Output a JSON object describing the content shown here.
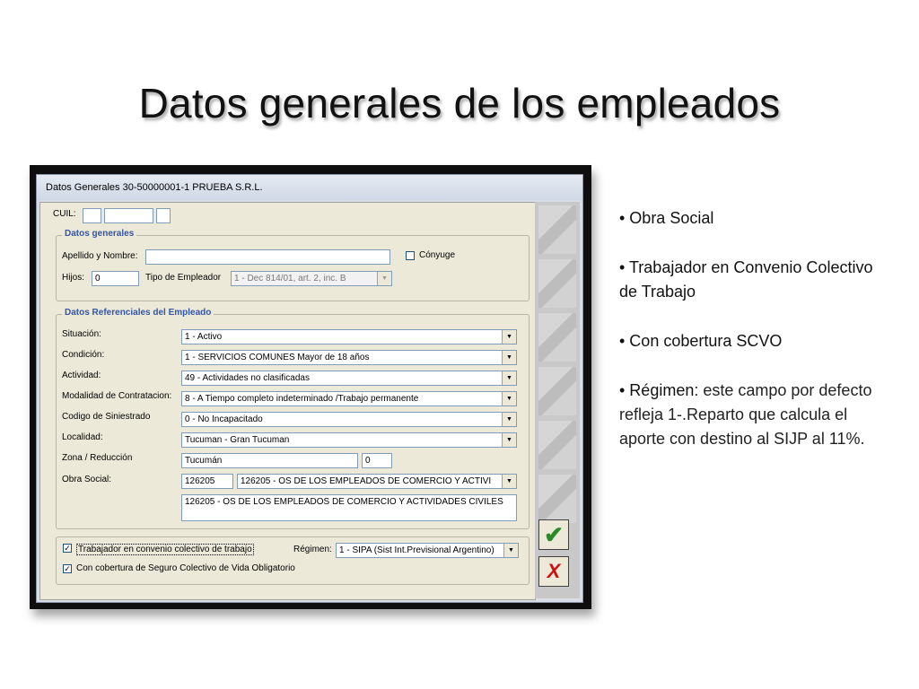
{
  "slide": {
    "title": "Datos generales de los empleados"
  },
  "window": {
    "title": "Datos Generales  30-50000001-1  PRUEBA S.R.L."
  },
  "form": {
    "cuil_label": "CUIL:",
    "group_general": "Datos generales",
    "apellido_label": "Apellido y Nombre:",
    "apellido_value": "",
    "conyuge_label": "Cónyuge",
    "hijos_label": "Hijos:",
    "hijos_value": "0",
    "tipo_empleador_label": "Tipo de Empleador",
    "tipo_empleador_value": "1 - Dec 814/01, art. 2, inc. B",
    "group_referenciales": "Datos Referenciales del Empleado",
    "fields": [
      {
        "label": "Situación:",
        "value": "1 - Activo"
      },
      {
        "label": "Condición:",
        "value": "1 - SERVICIOS COMUNES Mayor de 18 años"
      },
      {
        "label": "Actividad:",
        "value": "49 - Actividades no clasificadas"
      },
      {
        "label": "Modalidad de Contratacion:",
        "value": "8 - A Tiempo completo indeterminado /Trabajo permanente"
      },
      {
        "label": "Codigo de Siniestrado",
        "value": "0 - No Incapacitado"
      },
      {
        "label": "Localidad:",
        "value": "Tucuman - Gran Tucuman"
      }
    ],
    "zona_label": "Zona / Reducción",
    "zona_value": "Tucumán",
    "zona_pct": "0",
    "obra_social_label": "Obra Social:",
    "obra_social_code": "126205",
    "obra_social_select": "126205 - OS  DE LOS EMPLEADOS DE COMERCIO Y ACTIVI",
    "obra_social_full": "126205 - OS  DE LOS EMPLEADOS DE COMERCIO Y ACTIVIDADES CIVILES",
    "convenio_label": "Trabajador en convenio colectivo de trabajo",
    "regimen_label": "Régimen:",
    "regimen_value": "1 - SIPA (Sist Int.Previsional Argentino)",
    "scvo_label": "Con cobertura de Seguro Colectivo de Vida Obligatorio",
    "check_mark": "✓",
    "ok_glyph": "✔",
    "cancel_glyph": "X"
  },
  "bullets": {
    "b1": "• Obra Social",
    "b2": "• Trabajador en Convenio Colectivo de Trabajo",
    "b3": "• Con cobertura SCVO",
    "b4_head": "• Régimen",
    "b4_body": ": este campo por defecto refleja  1-.Reparto que calcula el aporte con destino al SIJP al 11%."
  },
  "colors": {
    "ok": "#2a8a2a",
    "cancel": "#cc1111",
    "group_title": "#3355aa"
  }
}
